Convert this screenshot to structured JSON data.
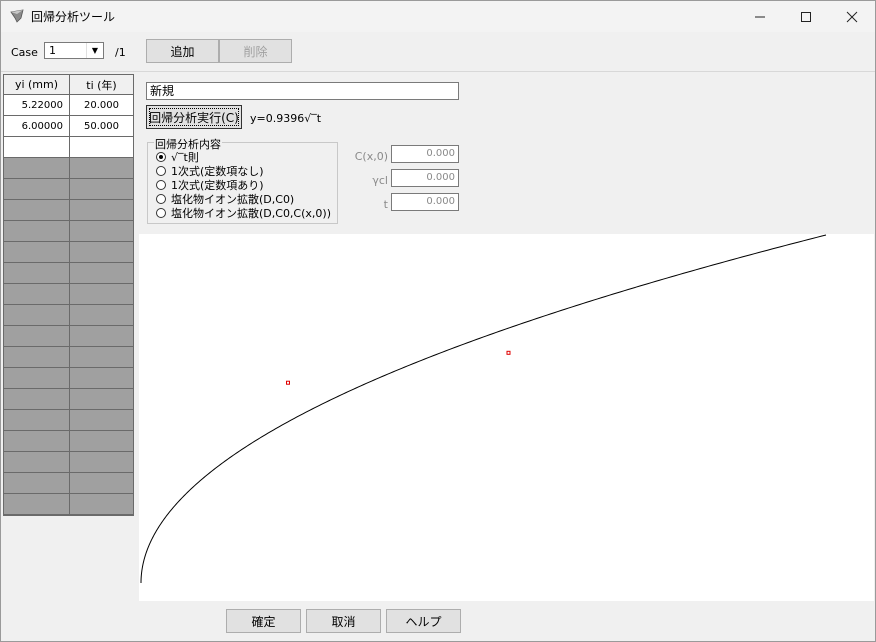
{
  "window": {
    "title": "回帰分析ツール"
  },
  "toolbar": {
    "case_label": "Case",
    "case_value": "1",
    "case_total": "/1",
    "add_label": "追加",
    "delete_label": "削除"
  },
  "grid": {
    "headers": [
      "yi (mm)",
      "ti (年)"
    ],
    "rows": [
      [
        "5.22000",
        "20.000"
      ],
      [
        "6.00000",
        "50.000"
      ]
    ]
  },
  "form": {
    "name_value": "新規",
    "run_label": "回帰分析実行(C)",
    "formula": "y=0.9396√‾t",
    "group_title": "回帰分析内容",
    "options": [
      "√‾t則",
      "1次式(定数項なし)",
      "1次式(定数項あり)",
      "塩化物イオン拡散(D,C0)",
      "塩化物イオン拡散(D,C0,C(x,0))"
    ],
    "selected_option": 0,
    "params": [
      {
        "label": "C(x,0)",
        "value": "0.000"
      },
      {
        "label": "γcl",
        "value": "0.000"
      },
      {
        "label": "t",
        "value": "0.000"
      }
    ]
  },
  "chart_data": {
    "type": "scatter",
    "points": [
      {
        "t": 20.0,
        "y": 5.22
      },
      {
        "t": 50.0,
        "y": 6.0
      }
    ],
    "fit": {
      "model": "sqrt",
      "coefficient": 0.9396
    },
    "point_color": "#e00000",
    "line_color": "#000000"
  },
  "footer": {
    "ok_label": "確定",
    "cancel_label": "取消",
    "help_label": "ヘルプ"
  }
}
